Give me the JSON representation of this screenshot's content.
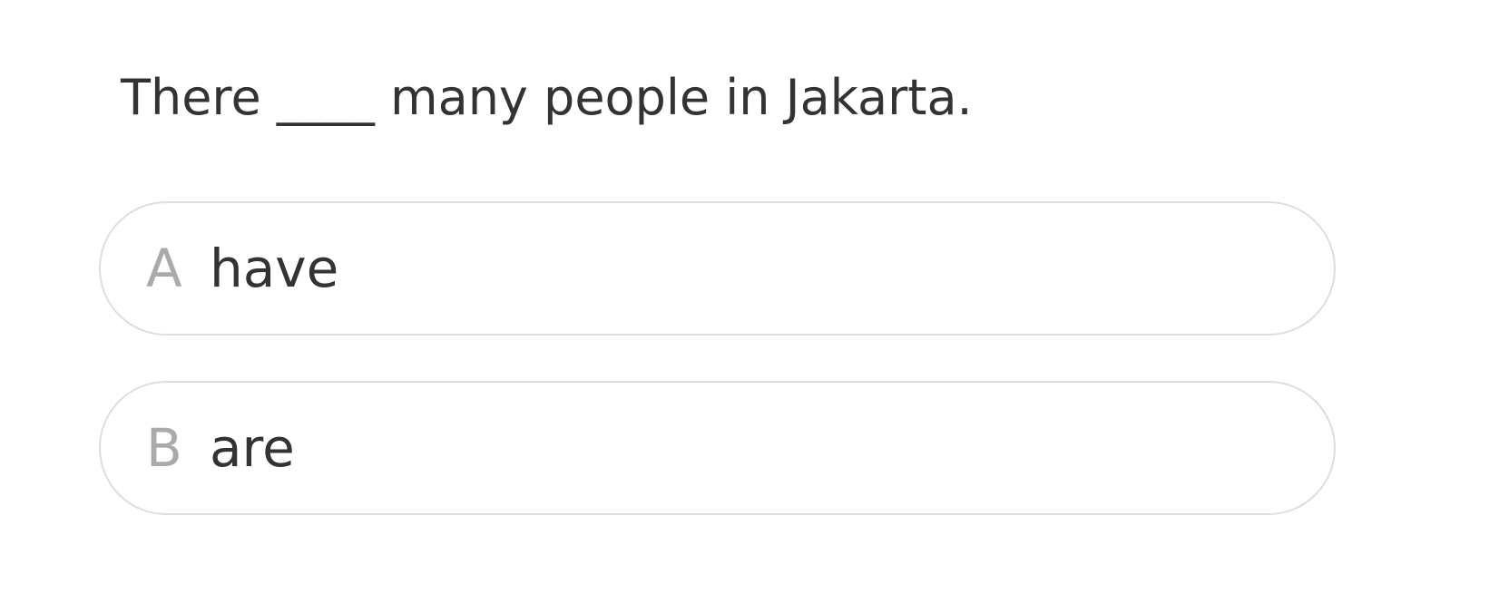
{
  "question": {
    "text": "There ____ many people in Jakarta."
  },
  "options": [
    {
      "letter": "A",
      "text": "have"
    },
    {
      "letter": "B",
      "text": "are"
    }
  ],
  "colors": {
    "text": "#333333",
    "letter": "#aaaaaa",
    "border": "#dedede",
    "background": "#ffffff"
  }
}
